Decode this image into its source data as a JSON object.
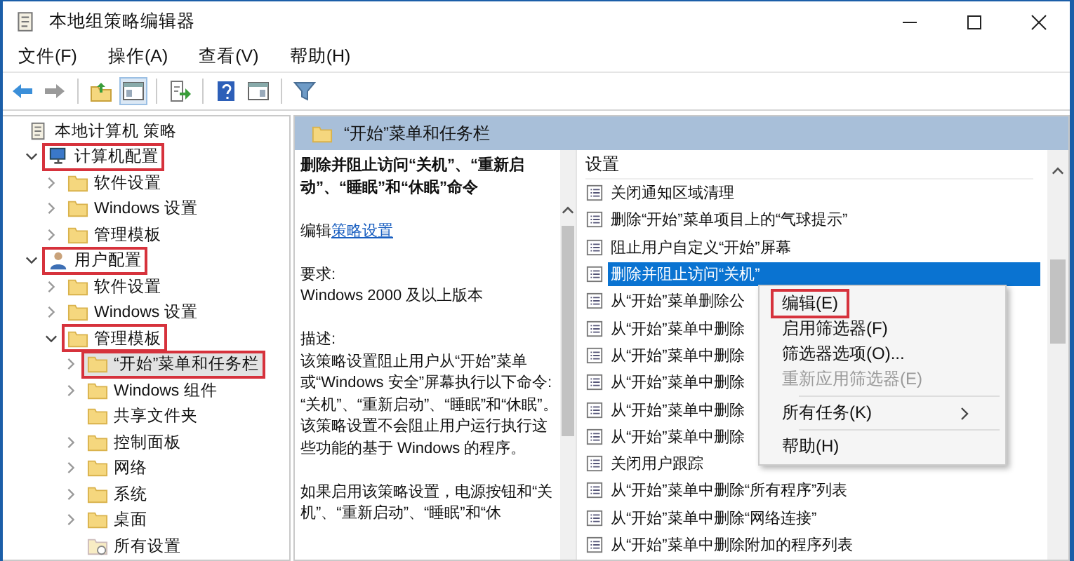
{
  "window": {
    "title": "本地组策略编辑器"
  },
  "menu": [
    "文件(F)",
    "操作(A)",
    "查看(V)",
    "帮助(H)"
  ],
  "toolbar": [
    {
      "kind": "back",
      "pressed": false
    },
    {
      "kind": "forward",
      "pressed": false
    },
    {
      "kind": "separator"
    },
    {
      "kind": "up",
      "pressed": false
    },
    {
      "kind": "tree",
      "pressed": true
    },
    {
      "kind": "separator"
    },
    {
      "kind": "export",
      "pressed": false
    },
    {
      "kind": "separator"
    },
    {
      "kind": "help",
      "pressed": false
    },
    {
      "kind": "pane",
      "pressed": false
    },
    {
      "kind": "separator"
    },
    {
      "kind": "filter",
      "pressed": false
    }
  ],
  "tree": [
    {
      "label": "本地计算机 策略",
      "kind": "policy",
      "selected": false,
      "highlighted": false,
      "children": [
        {
          "label": "计算机配置",
          "kind": "computer",
          "expanded": true,
          "selected": false,
          "highlighted": true,
          "children": [
            {
              "label": "软件设置",
              "kind": "folder",
              "expanded": false,
              "selected": false,
              "highlighted": false
            },
            {
              "label": "Windows 设置",
              "kind": "folder",
              "expanded": false,
              "selected": false,
              "highlighted": false
            },
            {
              "label": "管理模板",
              "kind": "folder",
              "expanded": false,
              "selected": false,
              "highlighted": false
            }
          ]
        },
        {
          "label": "用户配置",
          "kind": "user",
          "expanded": true,
          "selected": false,
          "highlighted": true,
          "children": [
            {
              "label": "软件设置",
              "kind": "folder",
              "expanded": false,
              "selected": false,
              "highlighted": false
            },
            {
              "label": "Windows 设置",
              "kind": "folder",
              "expanded": false,
              "selected": false,
              "highlighted": false
            },
            {
              "label": "管理模板",
              "kind": "folder",
              "expanded": true,
              "selected": false,
              "highlighted": true,
              "children": [
                {
                  "label": "“开始”菜单和任务栏",
                  "kind": "folder",
                  "expanded": false,
                  "selected": true,
                  "highlighted": true
                },
                {
                  "label": "Windows 组件",
                  "kind": "folder",
                  "expanded": false,
                  "selected": false,
                  "highlighted": false
                },
                {
                  "label": "共享文件夹",
                  "kind": "folder",
                  "selected": false,
                  "highlighted": false
                },
                {
                  "label": "控制面板",
                  "kind": "folder",
                  "expanded": false,
                  "selected": false,
                  "highlighted": false
                },
                {
                  "label": "网络",
                  "kind": "folder",
                  "expanded": false,
                  "selected": false,
                  "highlighted": false
                },
                {
                  "label": "系统",
                  "kind": "folder",
                  "expanded": false,
                  "selected": false,
                  "highlighted": false
                },
                {
                  "label": "桌面",
                  "kind": "folder",
                  "expanded": false,
                  "selected": false,
                  "highlighted": false
                },
                {
                  "label": "所有设置",
                  "kind": "settings",
                  "selected": false,
                  "highlighted": false
                }
              ]
            }
          ]
        }
      ]
    }
  ],
  "pane": {
    "title": "“开始”菜单和任务栏",
    "description": {
      "heading": "删除并阻止访问“关机”、“重新启动”、“睡眠”和“休眠”命令",
      "edit_prefix": "编辑",
      "edit_link": "策略设置",
      "requirements_label": "要求:",
      "requirements": "Windows 2000 及以上版本",
      "description_label": "描述:",
      "description": "该策略设置阻止用户从“开始”菜单或“Windows 安全”屏幕执行以下命令: “关机”、“重新启动”、“睡眠”和“休眠”。该策略设置不会阻止用户运行执行这些功能的基于 Windows 的程序。",
      "more": "如果启用该策略设置，电源按钮和“关机”、“重新启动”、“睡眠”和“休"
    },
    "settings": {
      "header": "设置",
      "rows": [
        {
          "label": "关闭通知区域清理",
          "selected": false
        },
        {
          "label": "删除“开始”菜单项目上的“气球提示”",
          "selected": false
        },
        {
          "label": "阻止用户自定义“开始”屏幕",
          "selected": false
        },
        {
          "label": "删除并阻止访问“关机”",
          "selected": true
        },
        {
          "label": "从“开始”菜单删除公",
          "selected": false
        },
        {
          "label": "从“开始”菜单中删除",
          "selected": false
        },
        {
          "label": "从“开始”菜单中删除",
          "selected": false
        },
        {
          "label": "从“开始”菜单中删除",
          "selected": false
        },
        {
          "label": "从“开始”菜单中删除",
          "selected": false
        },
        {
          "label": "从“开始”菜单中删除",
          "selected": false
        },
        {
          "label": "关闭用户跟踪",
          "selected": false
        },
        {
          "label": "从“开始”菜单中删除“所有程序”列表",
          "selected": false
        },
        {
          "label": "从“开始”菜单中删除“网络连接”",
          "selected": false
        },
        {
          "label": "从“开始”菜单中删除附加的程序列表",
          "selected": false
        }
      ]
    }
  },
  "context_menu": [
    {
      "kind": "item",
      "label": "编辑(E)",
      "disabled": false,
      "highlighted": true
    },
    {
      "kind": "item",
      "label": "启用筛选器(F)",
      "disabled": false,
      "highlighted": false
    },
    {
      "kind": "item",
      "label": "筛选器选项(O)...",
      "disabled": false,
      "highlighted": false
    },
    {
      "kind": "item",
      "label": "重新应用筛选器(E)",
      "disabled": true,
      "highlighted": false
    },
    {
      "kind": "separator"
    },
    {
      "kind": "submenu",
      "label": "所有任务(K)",
      "disabled": false,
      "highlighted": false
    },
    {
      "kind": "separator"
    },
    {
      "kind": "item",
      "label": "帮助(H)",
      "disabled": false,
      "highlighted": false
    }
  ]
}
